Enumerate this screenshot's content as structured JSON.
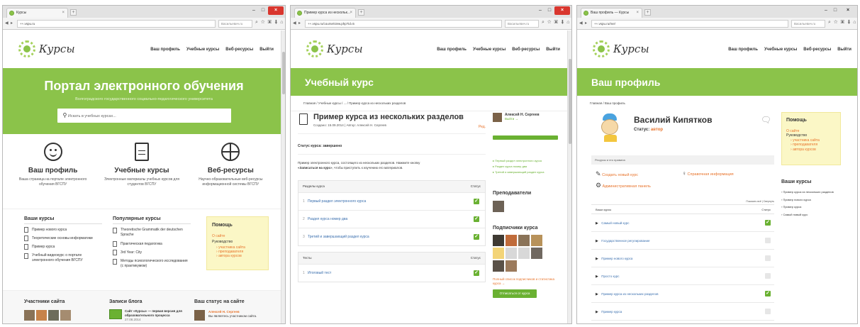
{
  "windows": [
    {
      "tab": "Курсы",
      "url": "++.vspu.ru",
      "search": "Васильевич.ru",
      "menu": [
        "Ваш профиль",
        "Учебные курсы",
        "Веб-ресурсы",
        "Выйти"
      ],
      "banner_title": "Портал электронного обучения",
      "banner_sub": "Волгоградского государственного социально-педагогического университета",
      "search_placeholder": "Искать в учебных курсах...",
      "features": [
        {
          "title": "Ваш профиль",
          "desc": "Ваша страница на портале электронного обучения ВГСПУ"
        },
        {
          "title": "Учебные курсы",
          "desc": "Электронные материалы учебных курсов для студентов ВГСПУ"
        },
        {
          "title": "Веб-ресурсы",
          "desc": "Научно-образовательные веб-ресурсы информационной системы ВГСПУ"
        }
      ],
      "your_courses_title": "Ваши курсы",
      "your_courses": [
        "Пример нового курса",
        "Теоретические основы информатики",
        "Пример курса",
        "Учебный видеокурс о портале электронного обучения ВГСПУ"
      ],
      "popular_title": "Популярные курсы",
      "popular": [
        "Theoretische Grammatik der deutschen Sprache",
        "Практическая педагогика",
        "3rd Year: City",
        "Методы психологического исследования (с практикумом)"
      ],
      "help_title": "Помощь",
      "help_about": "О сайте",
      "help_guide": "Руководство",
      "help_items": [
        "участника сайта",
        "преподавателя",
        "автора курсов"
      ],
      "participants_title": "Участники сайта",
      "blog_title": "Записи блога",
      "blog_text": "Сайт «Курсы» — первая версия для образовательного процесса",
      "blog_date": "27.08.2014",
      "status_title": "Ваш статус на сайте",
      "status_name": "Алексей Н. Сергеев",
      "status_text": "Вы являетесь участником сайта."
    },
    {
      "tab": "Пример курса из нескольк...",
      "url": "++.vspu.ru/course/view.php?id=5",
      "search": "Васильевич.ru",
      "menu": [
        "Ваш профиль",
        "Учебные курсы",
        "Веб-ресурсы",
        "Выйти"
      ],
      "banner_title": "Учебный курс",
      "crumb": "Главная / Учебные курсы / ... / Пример курса из нескольких разделов",
      "course_title": "Пример курса из нескольких разделов",
      "meta": "Создано: 15.09.2014 | Автор: Алексей Н. Сергеев",
      "edit": "Ред.",
      "status": "Статус курса: завершено",
      "intro_a": "Пример электронного курса, состоящего из нескольких разделов. Нажмите кнопку",
      "intro_b": "«Записаться на курс»",
      "intro_c": ", чтобы приступить к изучению его материалов.",
      "sections_header": "Разделы курса",
      "status_header": "Статус",
      "sections": [
        "Первый раздел электронного курса",
        "Раздел курса номер два",
        "Третий и завершающий раздел курса"
      ],
      "tests_header": "Тесты",
      "tests": [
        "Итоговый тест"
      ],
      "user_name": "Алексей Н. Сергеев",
      "user_logout": "Выйти →",
      "side_links": [
        "Первый раздел электронного курса",
        "Раздел курса номер два",
        "Третий и завершающий раздел курса"
      ],
      "teachers_title": "Преподаватели",
      "subs_title": "Подписчики курса",
      "subs_link": "Полный список подписчиков и статистика курса →",
      "unsub_button": "Отписаться от курса"
    },
    {
      "tab": "Ваш профиль — Курсы",
      "url": "++.vspu.ru/me/",
      "search": "Васильевич.ru",
      "menu": [
        "Ваш профиль",
        "Учебные курсы",
        "Веб-ресурсы",
        "Выйти"
      ],
      "banner_title": "Ваш профиль",
      "crumb": "Главная / Ваш профиль",
      "name": "Василий Кипятков",
      "status_label": "Статус:",
      "status_value": "автор",
      "rights": "Ресурсы и его правила",
      "create": "Создать новый курс",
      "reference": "Справочная информация",
      "admin": "Административная панель",
      "show_hide": "Показать всё | Свернуть",
      "table_head": "Ваши курсы",
      "table_status": "Статус",
      "courses": [
        {
          "name": "Самый новый курс",
          "done": true
        },
        {
          "name": "Государственное регулирование",
          "done": false
        },
        {
          "name": "Пример нового курса",
          "done": false
        },
        {
          "name": "Просто курс",
          "done": false
        },
        {
          "name": "Пример курса из нескольких разделов",
          "done": true
        },
        {
          "name": "Пример курса",
          "done": false
        }
      ],
      "help_title": "Помощь",
      "help_about": "О сайте",
      "help_guide": "Руководство",
      "help_items": [
        "участника сайта",
        "преподавателя",
        "автора курсов"
      ],
      "side_title": "Ваши курсы",
      "side_courses": [
        "Пример курса из нескольких разделов",
        "Пример нового курса",
        "Пример курса",
        "Самый новый курс"
      ]
    }
  ],
  "colors": {
    "accent": "#8bc34a",
    "link": "#3a6fae",
    "orange": "#e8742c",
    "help_bg": "#fbf7c6"
  }
}
